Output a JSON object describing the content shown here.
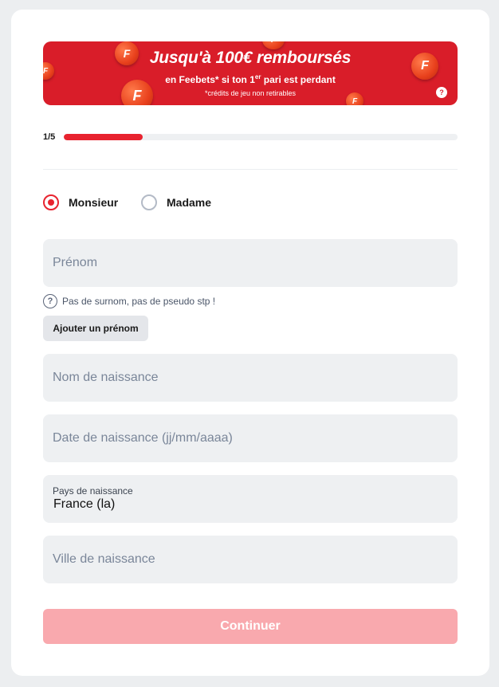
{
  "banner": {
    "title": "Jusqu'à 100€ remboursés",
    "subtitle_prefix": "en Feebets* si ton 1",
    "subtitle_sup": "er",
    "subtitle_suffix": " pari est perdant",
    "note": "*crédits de jeu non retirables",
    "coin_letter": "F",
    "help": "?"
  },
  "progress": {
    "label": "1/5",
    "fraction": 0.2
  },
  "gender": {
    "options": [
      {
        "label": "Monsieur",
        "checked": true
      },
      {
        "label": "Madame",
        "checked": false
      }
    ]
  },
  "form": {
    "first_name_placeholder": "Prénom",
    "hint_text": "Pas de surnom, pas de pseudo stp !",
    "hint_icon": "?",
    "add_first_name": "Ajouter un prénom",
    "birth_name_placeholder": "Nom de naissance",
    "birth_date_placeholder": "Date de naissance (jj/mm/aaaa)",
    "birth_country_label": "Pays de naissance",
    "birth_country_value": "France (la)",
    "birth_city_placeholder": "Ville de naissance"
  },
  "actions": {
    "continue": "Continuer"
  },
  "colors": {
    "accent": "#e8232f",
    "banner": "#d91d29",
    "disabled_button": "#f9a9ae"
  }
}
